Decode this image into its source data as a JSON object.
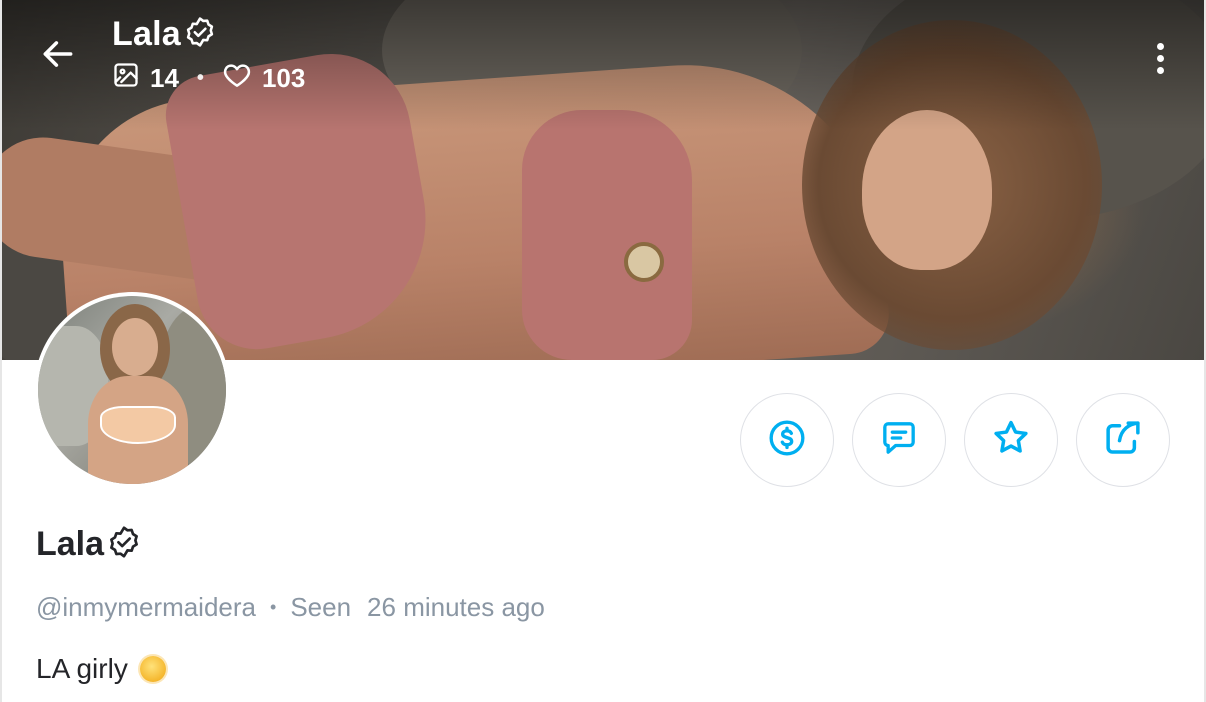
{
  "header": {
    "title": "Lala",
    "media_count": "14",
    "likes_count": "103",
    "separator": "•"
  },
  "profile": {
    "name": "Lala",
    "handle": "@inmymermaidera",
    "separator": "•",
    "seen_label": "Seen",
    "seen_time": "26 minutes ago",
    "bio_text": "LA girly"
  },
  "icons": {
    "back": "arrow-left-icon",
    "verified": "verified-badge-icon",
    "media": "image-icon",
    "likes": "heart-icon",
    "more": "more-vertical-icon",
    "tip": "dollar-circle-icon",
    "message": "message-icon",
    "favorite": "star-icon",
    "share": "share-icon",
    "bio_emoji": "sun-emoji"
  },
  "colors": {
    "accent": "#00aff0",
    "text_primary": "#242529",
    "text_secondary": "#8a96a3",
    "button_border": "#dfe1e6"
  }
}
